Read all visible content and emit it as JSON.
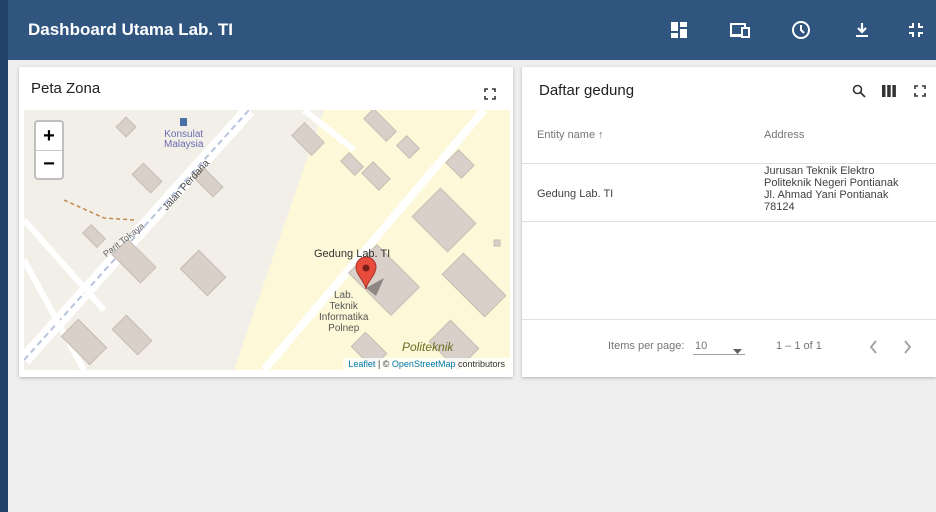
{
  "header": {
    "title": "Dashboard Utama Lab. TI",
    "icons": [
      "dashboard-icon",
      "devices-icon",
      "history-icon",
      "download-icon",
      "fullscreen-exit-icon"
    ],
    "bg_color": "#305680"
  },
  "map_widget": {
    "title": "Peta Zona",
    "zoom_in": "+",
    "zoom_out": "−",
    "labels": {
      "konsulat": "Konsulat\nMalaysia",
      "jalan_perdana": "Jalan Perdana",
      "parit_tokaya": "Parit Tokaya",
      "gedung": "Gedung Lab. TI",
      "lab": "Lab.\nTeknik\nInformatika\nPolnep",
      "politeknik": "Politeknik"
    },
    "attribution": {
      "leaflet": "Leaflet",
      "sep": " | © ",
      "osm": "OpenStreetMap",
      "contrib": " contributors"
    }
  },
  "table_widget": {
    "title": "Daftar gedung",
    "columns": {
      "entity": "Entity name ↑",
      "address": "Address"
    },
    "rows": [
      {
        "entity": "Gedung Lab. TI",
        "address_lines": [
          "Jurusan Teknik Elektro",
          "Politeknik Negeri Pontianak",
          "Jl. Ahmad Yani Pontianak",
          "78124"
        ]
      }
    ],
    "pagination": {
      "items_per_page_label": "Items per page:",
      "page_size": "10",
      "range": "1 – 1 of 1"
    }
  }
}
